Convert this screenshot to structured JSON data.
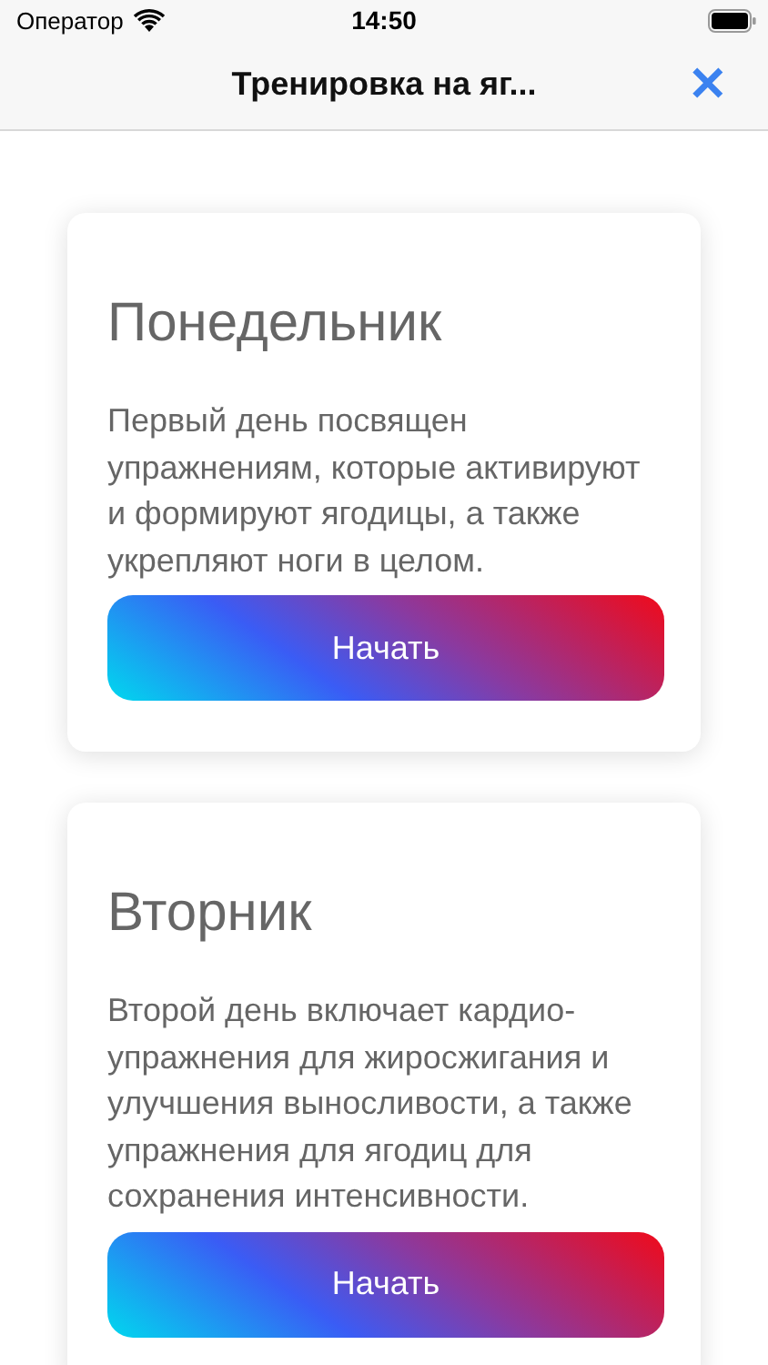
{
  "status_bar": {
    "carrier": "Оператор",
    "time": "14:50"
  },
  "header": {
    "title": "Тренировка на яг...",
    "close": "✕"
  },
  "days": [
    {
      "title": "Понедельник",
      "description": "Первый день посвящен упражнениям, которые активируют и формируют ягодицы, а также укрепляют ноги в целом.",
      "button": "Начать"
    },
    {
      "title": "Вторник",
      "description": "Второй день включает кардио-упражнения для жиросжигания и улучшения выносливости, а также упражнения для ягодиц для сохранения интенсивности.",
      "button": "Начать"
    }
  ]
}
